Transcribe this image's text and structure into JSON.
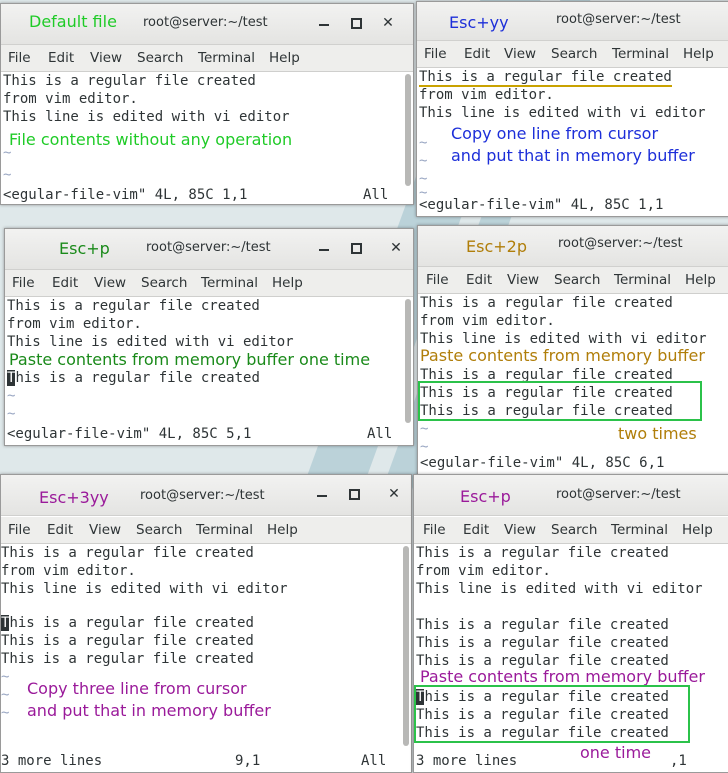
{
  "window_title": "root@server:~/test",
  "menu": [
    "File",
    "Edit",
    "View",
    "Search",
    "Terminal",
    "Help"
  ],
  "colors": {
    "green_annotation": "#1fcb27",
    "blue_annotation": "#1d2fd9",
    "olive_annotation": "#b07e0a",
    "purple_annotation": "#9a1a9a",
    "highlight_box": "#2bc24a",
    "terminal_text": "#2e3436"
  },
  "panels": {
    "p1": {
      "annotation": "Default file",
      "lines": [
        "This is a regular file created",
        "from vim editor.",
        "This line is edited with vi editor"
      ],
      "tildes": [
        "~",
        "~"
      ],
      "note": "File contents without any operation",
      "status_left": "<egular-file-vim\" 4L, 85C 1,1",
      "status_right": "All"
    },
    "p2": {
      "annotation": "Esc+yy",
      "lines": [
        "This is a regular file created",
        "from vim editor.",
        "This line is edited with vi editor"
      ],
      "tildes": [
        "~",
        "~",
        "~",
        "~"
      ],
      "note1": "Copy one line from cursor",
      "note2": "and put that in memory buffer",
      "status_left": "<egular-file-vim\" 4L, 85C 1,1"
    },
    "p3": {
      "annotation": "Esc+p",
      "lines": [
        "This is a regular file created",
        "from vim editor.",
        "This line is edited with vi editor"
      ],
      "note": "Paste contents from memory buffer one time",
      "pasted_cursor": "T",
      "pasted_rest": "his is a regular file created",
      "tildes": [
        "~",
        "~"
      ],
      "status_left": "<egular-file-vim\" 4L, 85C 5,1",
      "status_right": "All"
    },
    "p4": {
      "annotation": "Esc+2p",
      "lines": [
        "This is a regular file created",
        "from vim editor.",
        "This line is edited with vi editor"
      ],
      "note": "Paste contents from memory buffer",
      "line4": "This is a regular file created",
      "pasted": [
        "This is a regular file created",
        "This is a regular file created"
      ],
      "tildes": [
        "~",
        "~"
      ],
      "note2": "two times",
      "status_left": "<egular-file-vim\" 4L, 85C 6,1"
    },
    "p5": {
      "annotation": "Esc+3yy",
      "lines": [
        "This is a regular file created",
        "from vim editor.",
        "This line is edited with vi editor"
      ],
      "cursor_char": "T",
      "copied_rest": "his is a regular file created",
      "copied": [
        "This is a regular file created",
        "This is a regular file created"
      ],
      "tildes": [
        "~",
        "~",
        "~"
      ],
      "note1": "Copy three line from cursor",
      "note2": "and put that in memory buffer",
      "status_left": "3 more lines",
      "status_pos": "9,1",
      "status_right": "All"
    },
    "p6": {
      "annotation": "Esc+p",
      "lines": [
        "This is a regular file created",
        "from vim editor.",
        "This line is edited with vi editor"
      ],
      "block": [
        "This is a regular file created",
        "This is a regular file created",
        "This is a regular file created"
      ],
      "note": "Paste contents from memory buffer",
      "pasted_cursor": "T",
      "pasted_first_rest": "his is a regular file created",
      "pasted_more": [
        "This is a regular file created",
        "This is a regular file created"
      ],
      "note2": "one time",
      "status_left": "3 more lines",
      "status_pos": ",1"
    }
  }
}
